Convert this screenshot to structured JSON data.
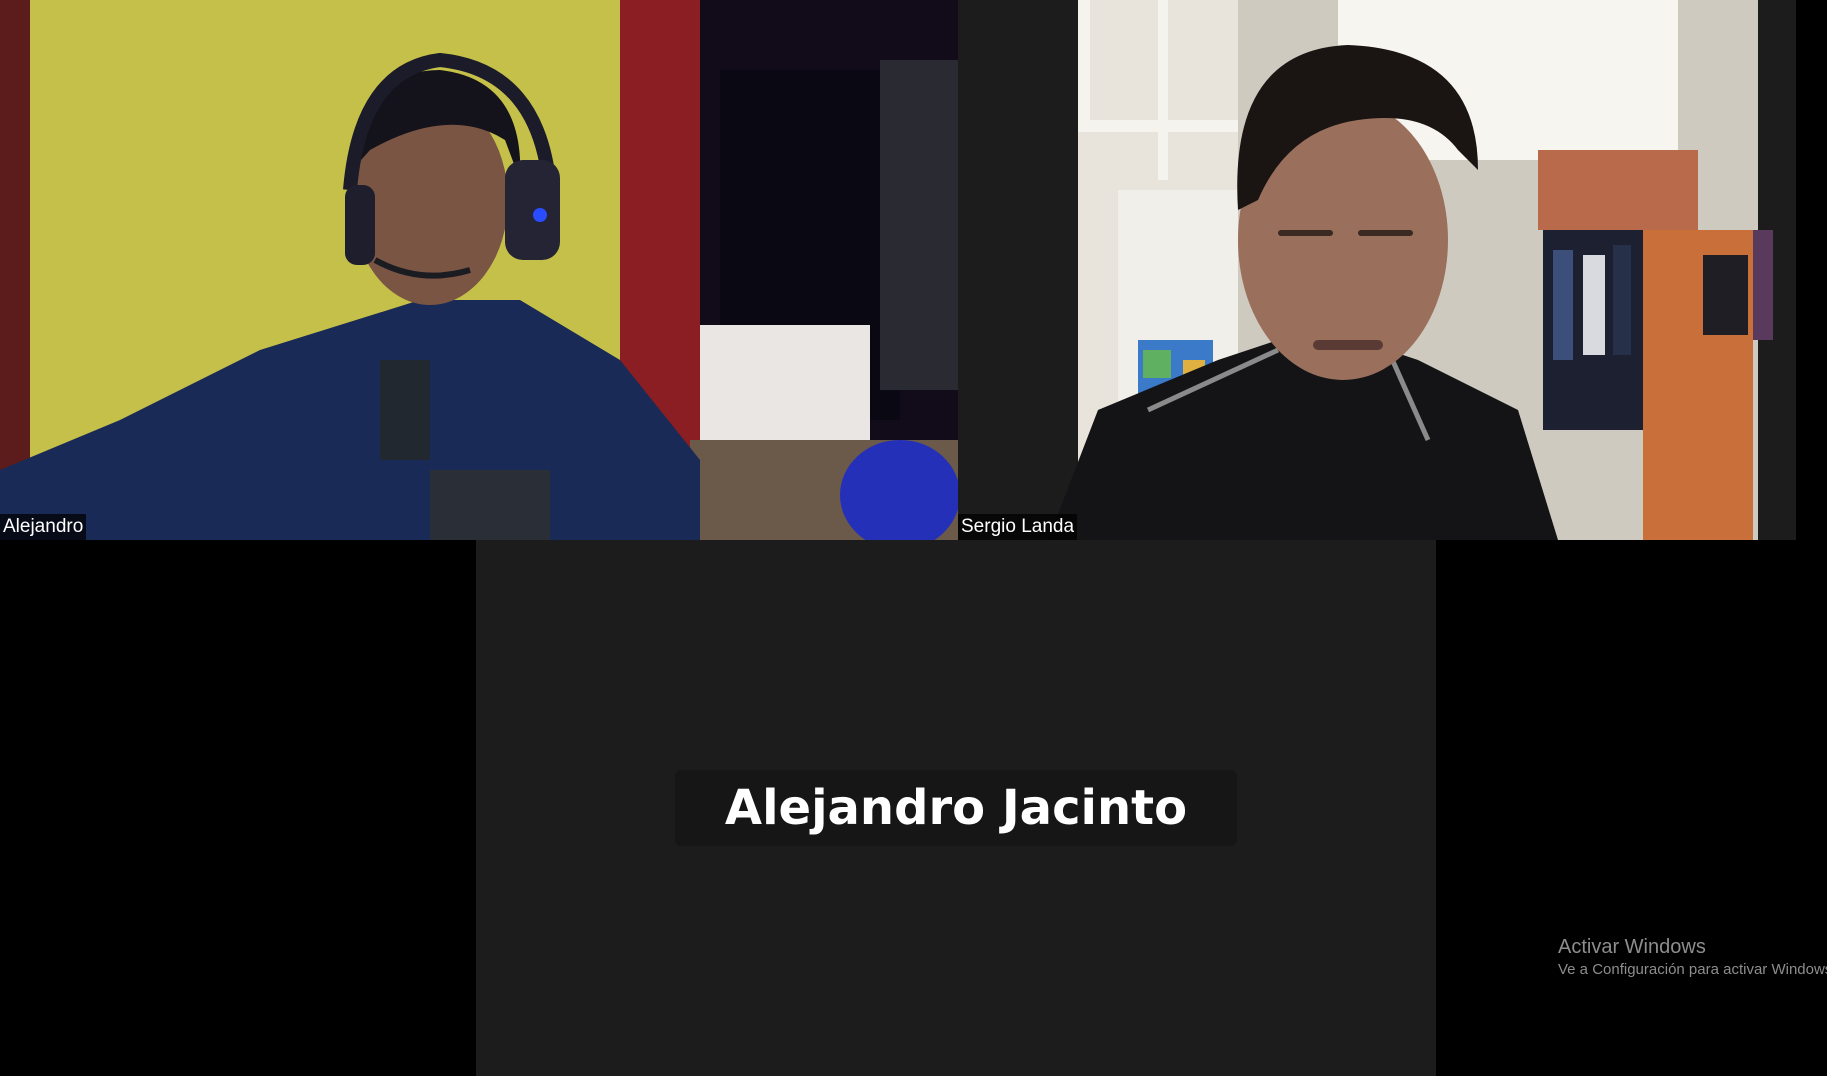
{
  "participants": [
    {
      "name": "Alejandro",
      "video": "on"
    },
    {
      "name": "Sergio Landa",
      "video": "on"
    },
    {
      "name": "Alejandro Jacinto",
      "video": "off"
    }
  ],
  "watermark": {
    "title": "Activar Windows",
    "subtitle": "Ve a Configuración para activar Windows."
  },
  "colors": {
    "background": "#000000",
    "tile_background": "#1c1c1c",
    "name_text": "#ffffff",
    "watermark_text": "#8d8d8d"
  }
}
